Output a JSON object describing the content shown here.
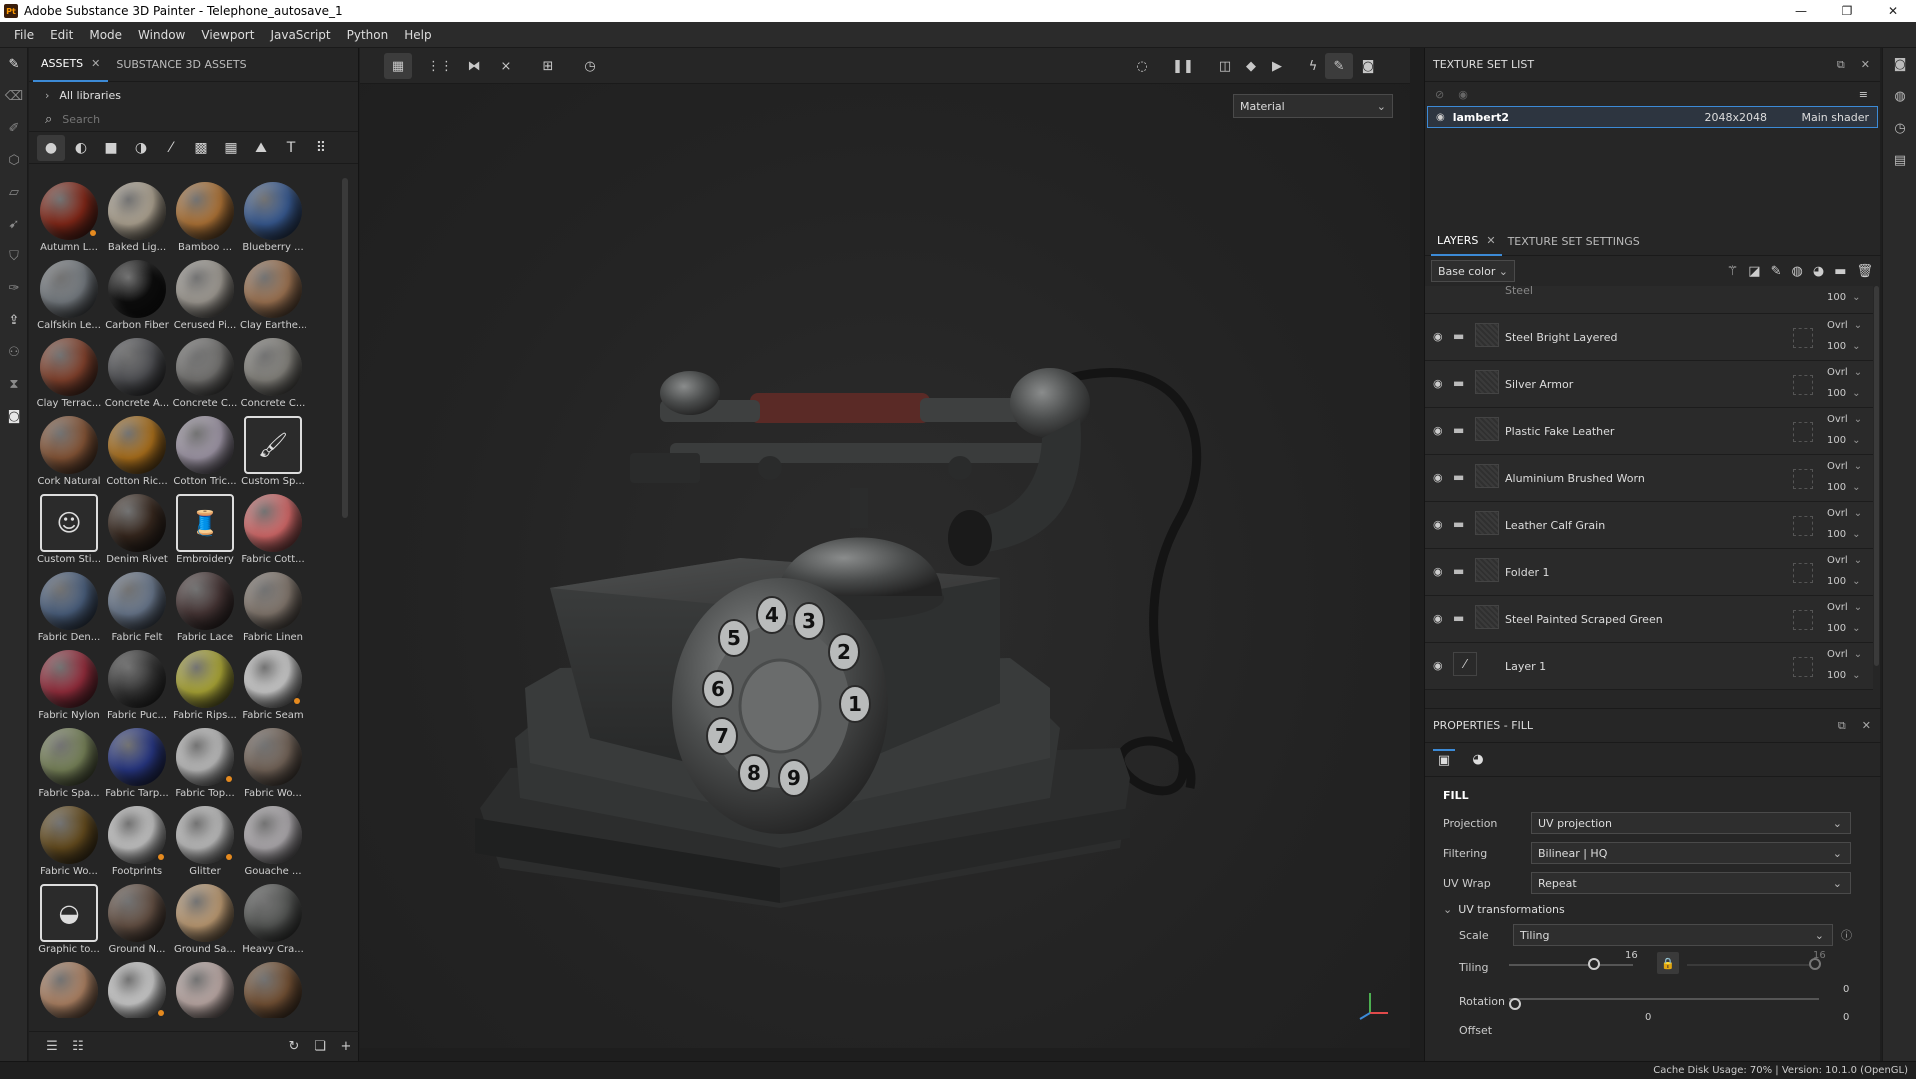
{
  "window": {
    "app_logo": "Pt",
    "title": "Adobe Substance 3D Painter - Telephone_autosave_1"
  },
  "menu": [
    "File",
    "Edit",
    "Mode",
    "Window",
    "Viewport",
    "JavaScript",
    "Python",
    "Help"
  ],
  "assets_panel": {
    "tabs": [
      {
        "label": "ASSETS",
        "active": true
      },
      {
        "label": "SUBSTANCE 3D ASSETS",
        "active": false
      }
    ],
    "libraries_label": "All libraries",
    "search_placeholder": "Search",
    "filter_icons": [
      "material-icon",
      "smart-material-icon",
      "mask-icon",
      "smart-mask-icon",
      "brush-icon",
      "texture-icon",
      "pattern-icon",
      "environment-icon",
      "text-icon",
      "grid-icon"
    ],
    "items": [
      {
        "label": "Autumn L...",
        "color": "#8a2a1a",
        "badge": true
      },
      {
        "label": "Baked Lig...",
        "color": "#b8ad9a",
        "badge": false
      },
      {
        "label": "Bamboo ...",
        "color": "#b87a3a",
        "badge": false
      },
      {
        "label": "Blueberry ...",
        "color": "#3b5f99",
        "badge": false
      },
      {
        "label": "Calfskin Le...",
        "color": "#7c8288",
        "badge": false
      },
      {
        "label": "Carbon Fiber",
        "color": "#0e0e0e",
        "badge": false
      },
      {
        "label": "Cerused Pi...",
        "color": "#a9a49c",
        "badge": false
      },
      {
        "label": "Clay Earthe...",
        "color": "#a67a57",
        "badge": false
      },
      {
        "label": "Clay Terrac...",
        "color": "#8a4630",
        "badge": false
      },
      {
        "label": "Concrete A...",
        "color": "#55565a",
        "badge": false
      },
      {
        "label": "Concrete C...",
        "color": "#7b7a78",
        "badge": false
      },
      {
        "label": "Concrete C...",
        "color": "#8c8a84",
        "badge": false
      },
      {
        "label": "Cork Natural",
        "color": "#8d5a3a",
        "badge": false
      },
      {
        "label": "Cotton Ric...",
        "color": "#b4761e",
        "badge": false
      },
      {
        "label": "Cotton Tric...",
        "color": "#a89fb0",
        "badge": false
      },
      {
        "label": "Custom Sp...",
        "color": "#2b2b2b",
        "square": true,
        "glyph": "🖌"
      },
      {
        "label": "Custom Sti...",
        "color": "#2b2b2b",
        "square": true,
        "glyph": "☺"
      },
      {
        "label": "Denim Rivet",
        "color": "#3a2a20",
        "badge": false
      },
      {
        "label": "Embroidery",
        "color": "#2b2b2b",
        "square": true,
        "glyph": "🧵"
      },
      {
        "label": "Fabric Cott...",
        "color": "#e07070",
        "badge": false
      },
      {
        "label": "Fabric Den...",
        "color": "#4f6585",
        "badge": false
      },
      {
        "label": "Fabric Felt",
        "color": "#6f7e94",
        "badge": false
      },
      {
        "label": "Fabric Lace",
        "color": "#4a3838",
        "badge": false
      },
      {
        "label": "Fabric Linen",
        "color": "#8a7e74",
        "badge": false
      },
      {
        "label": "Fabric Nylon",
        "color": "#9c3040",
        "badge": false
      },
      {
        "label": "Fabric Puc...",
        "color": "#3a3a3a",
        "badge": false
      },
      {
        "label": "Fabric Rips...",
        "color": "#b5b03a",
        "badge": false
      },
      {
        "label": "Fabric Seam",
        "color": "#d8d8d8",
        "badge": true
      },
      {
        "label": "Fabric Spa...",
        "color": "#7e8a5e",
        "badge": false
      },
      {
        "label": "Fabric Tarp...",
        "color": "#2a3a8a",
        "badge": false
      },
      {
        "label": "Fabric Top...",
        "color": "#c8c8c8",
        "badge": true
      },
      {
        "label": "Fabric Wo...",
        "color": "#7a6a5e",
        "badge": false
      },
      {
        "label": "Fabric Wo...",
        "color": "#6a5020",
        "badge": false
      },
      {
        "label": "Footprints",
        "color": "#d0d0d0",
        "badge": true
      },
      {
        "label": "Glitter",
        "color": "#c8c8c8",
        "badge": true
      },
      {
        "label": "Gouache ...",
        "color": "#b8b4b8",
        "badge": false
      },
      {
        "label": "Graphic to...",
        "color": "#2b2b2b",
        "square": true,
        "glyph": "◒"
      },
      {
        "label": "Ground N...",
        "color": "#6a5548",
        "badge": false
      },
      {
        "label": "Ground Sa...",
        "color": "#c8a47a",
        "badge": false
      },
      {
        "label": "Heavy Cra...",
        "color": "#5a5c5a",
        "badge": false
      },
      {
        "label": "",
        "color": "#b88a6a",
        "badge": false
      },
      {
        "label": "",
        "color": "#d8d8d8",
        "badge": true
      },
      {
        "label": "",
        "color": "#c8b4b0",
        "badge": false
      },
      {
        "label": "",
        "color": "#7a5638",
        "badge": false
      }
    ]
  },
  "viewport": {
    "material_select": "Material"
  },
  "texture_set_list": {
    "title": "TEXTURE SET LIST",
    "row": {
      "name": "lambert2",
      "resolution": "2048x2048",
      "shader": "Main shader"
    }
  },
  "layers": {
    "tabs": [
      {
        "label": "LAYERS",
        "active": true
      },
      {
        "label": "TEXTURE SET SETTINGS",
        "active": false
      }
    ],
    "channel": "Base color",
    "partial_row": {
      "name": "Steel",
      "opacity": "100"
    },
    "items": [
      {
        "name": "Steel Bright Layered",
        "blend": "Ovrl",
        "opacity": "100",
        "type": "folder"
      },
      {
        "name": "Silver Armor",
        "blend": "Ovrl",
        "opacity": "100",
        "type": "folder"
      },
      {
        "name": "Plastic Fake Leather",
        "blend": "Ovrl",
        "opacity": "100",
        "type": "folder"
      },
      {
        "name": "Aluminium Brushed Worn",
        "blend": "Ovrl",
        "opacity": "100",
        "type": "folder"
      },
      {
        "name": "Leather Calf Grain",
        "blend": "Ovrl",
        "opacity": "100",
        "type": "folder"
      },
      {
        "name": "Folder 1",
        "blend": "Ovrl",
        "opacity": "100",
        "type": "folder"
      },
      {
        "name": "Steel Painted Scraped Green",
        "blend": "Ovrl",
        "opacity": "100",
        "type": "folder"
      },
      {
        "name": "Layer 1",
        "blend": "Ovrl",
        "opacity": "100",
        "type": "paint"
      }
    ]
  },
  "properties": {
    "title": "PROPERTIES - FILL",
    "section": "FILL",
    "projection_label": "Projection",
    "projection_value": "UV projection",
    "filtering_label": "Filtering",
    "filtering_value": "Bilinear | HQ",
    "uvwrap_label": "UV Wrap",
    "uvwrap_value": "Repeat",
    "uv_transformations": "UV transformations",
    "scale_label": "Scale",
    "scale_value": "Tiling",
    "tiling_label": "Tiling",
    "tiling_value": "16",
    "tiling_value_2": "16",
    "tiling_fraction": 0.64,
    "rotation_label": "Rotation",
    "rotation_value": "0",
    "offset_label": "Offset",
    "offset_x": "0",
    "offset_y": "0"
  },
  "status": "Cache Disk Usage:   70% | Version: 10.1.0 (OpenGL)"
}
